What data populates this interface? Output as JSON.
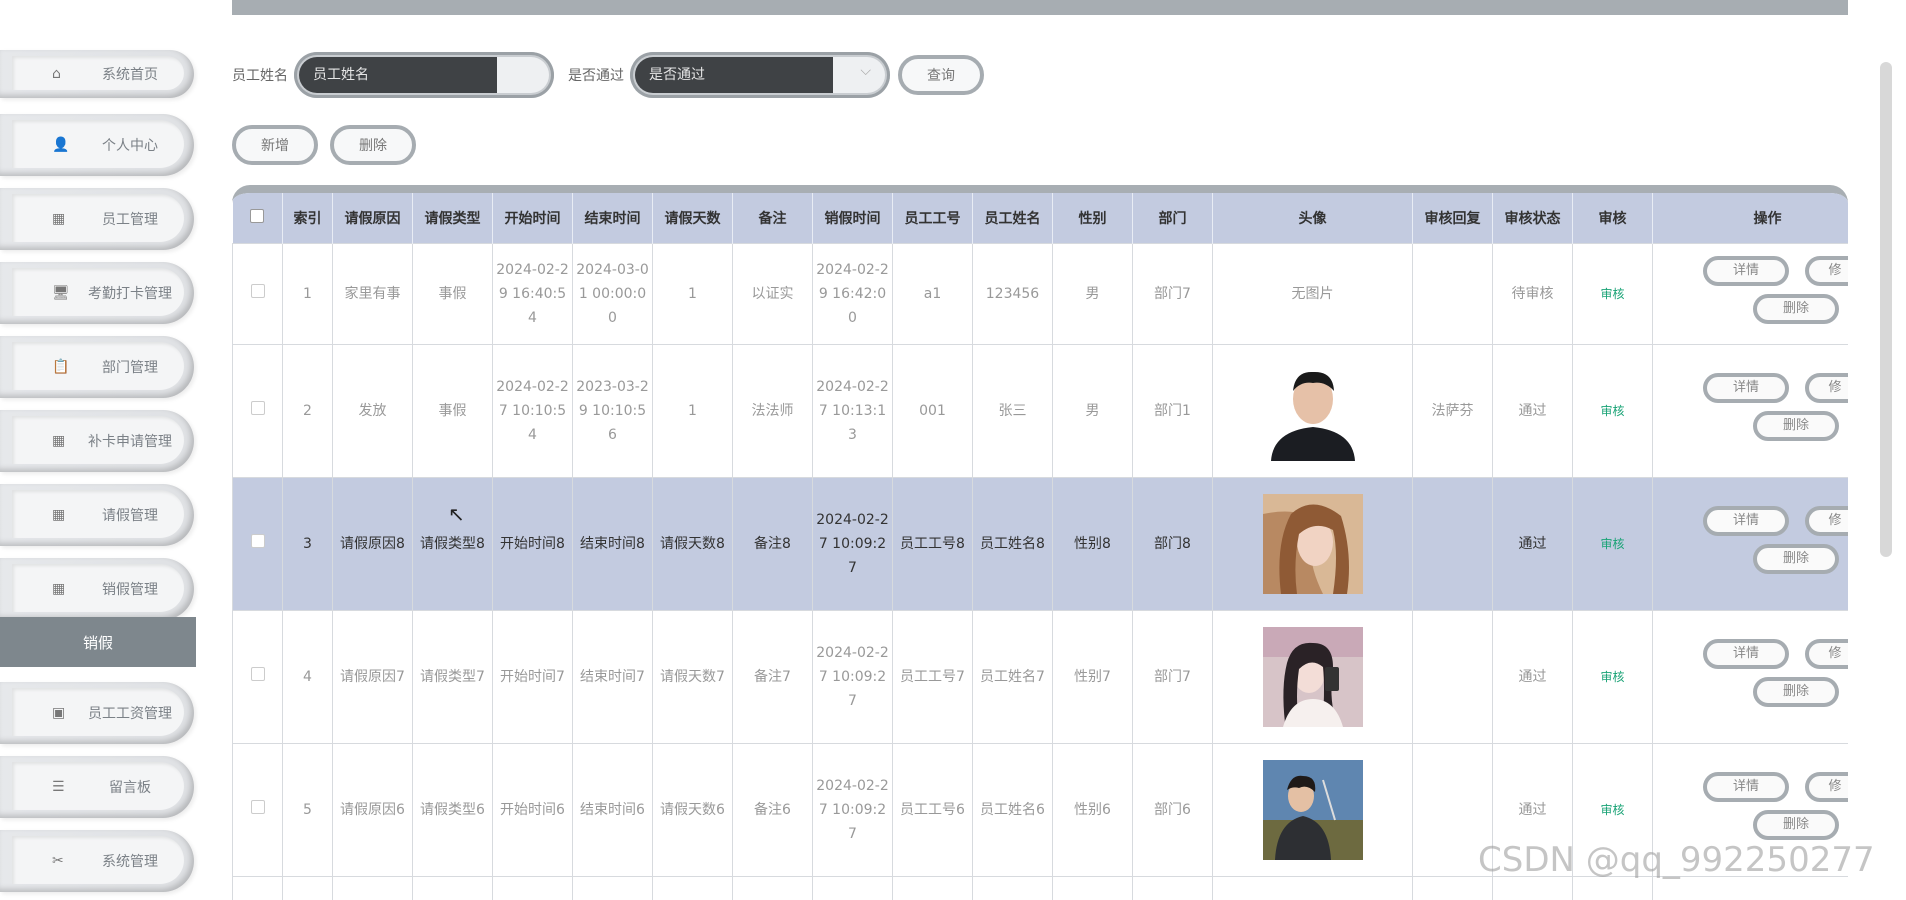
{
  "sidebar": {
    "items": [
      {
        "icon": "⌂",
        "label": "系统首页"
      },
      {
        "icon": "👤",
        "label": "个人中心"
      },
      {
        "icon": "▦",
        "label": "员工管理"
      },
      {
        "icon": "🖥",
        "label": "考勤打卡管理"
      },
      {
        "icon": "📋",
        "label": "部门管理"
      },
      {
        "icon": "▦",
        "label": "补卡申请管理"
      },
      {
        "icon": "▦",
        "label": "请假管理"
      },
      {
        "icon": "▦",
        "label": "销假管理"
      },
      {
        "icon": "▣",
        "label": "员工工资管理"
      },
      {
        "icon": "☰",
        "label": "留言板"
      },
      {
        "icon": "✂",
        "label": "系统管理"
      }
    ],
    "submenu": "销假"
  },
  "search": {
    "name_label": "员工姓名",
    "name_placeholder": "员工姓名",
    "pass_label": "是否通过",
    "pass_placeholder": "是否通过",
    "query_btn": "查询"
  },
  "actions": {
    "add": "新增",
    "delete": "删除"
  },
  "table": {
    "headers": [
      "索引",
      "请假原因",
      "请假类型",
      "开始时间",
      "结束时间",
      "请假天数",
      "备注",
      "销假时间",
      "员工工号",
      "员工姓名",
      "性别",
      "部门",
      "头像",
      "审核回复",
      "审核状态",
      "审核",
      "操作"
    ],
    "rows": [
      {
        "idx": "1",
        "reason": "家里有事",
        "type": "事假",
        "start": "2024-02-29 16:40:54",
        "end": "2024-03-01 00:00:00",
        "days": "1",
        "note": "以证实",
        "cancel": "2024-02-29 16:42:00",
        "no": "a1",
        "name": "123456",
        "gender": "男",
        "dept": "部门7",
        "avatar": "无图片",
        "reply": "",
        "status": "待审核",
        "verify": "审核"
      },
      {
        "idx": "2",
        "reason": "发放",
        "type": "事假",
        "start": "2024-02-27 10:10:54",
        "end": "2023-03-29 10:10:56",
        "days": "1",
        "note": "法法师",
        "cancel": "2024-02-27 10:13:13",
        "no": "001",
        "name": "张三",
        "gender": "男",
        "dept": "部门1",
        "avatar": "",
        "reply": "法萨芬",
        "status": "通过",
        "verify": "审核"
      },
      {
        "idx": "3",
        "reason": "请假原因8",
        "type": "请假类型8",
        "start": "开始时间8",
        "end": "结束时间8",
        "days": "请假天数8",
        "note": "备注8",
        "cancel": "2024-02-27 10:09:27",
        "no": "员工工号8",
        "name": "员工姓名8",
        "gender": "性别8",
        "dept": "部门8",
        "avatar": "",
        "reply": "",
        "status": "通过",
        "verify": "审核"
      },
      {
        "idx": "4",
        "reason": "请假原因7",
        "type": "请假类型7",
        "start": "开始时间7",
        "end": "结束时间7",
        "days": "请假天数7",
        "note": "备注7",
        "cancel": "2024-02-27 10:09:27",
        "no": "员工工号7",
        "name": "员工姓名7",
        "gender": "性别7",
        "dept": "部门7",
        "avatar": "",
        "reply": "",
        "status": "通过",
        "verify": "审核"
      },
      {
        "idx": "5",
        "reason": "请假原因6",
        "type": "请假类型6",
        "start": "开始时间6",
        "end": "结束时间6",
        "days": "请假天数6",
        "note": "备注6",
        "cancel": "2024-02-27 10:09:27",
        "no": "员工工号6",
        "name": "员工姓名6",
        "gender": "性别6",
        "dept": "部门6",
        "avatar": "",
        "reply": "",
        "status": "通过",
        "verify": "审核"
      }
    ],
    "op_labels": {
      "detail": "详情",
      "edit": "修",
      "delete": "删除"
    }
  },
  "watermark": "CSDN @qq_992250277",
  "colors": {
    "header_bg": "#c3cbe0",
    "accent_green": "#1aa376",
    "sidebar_active": "#7e878d"
  }
}
